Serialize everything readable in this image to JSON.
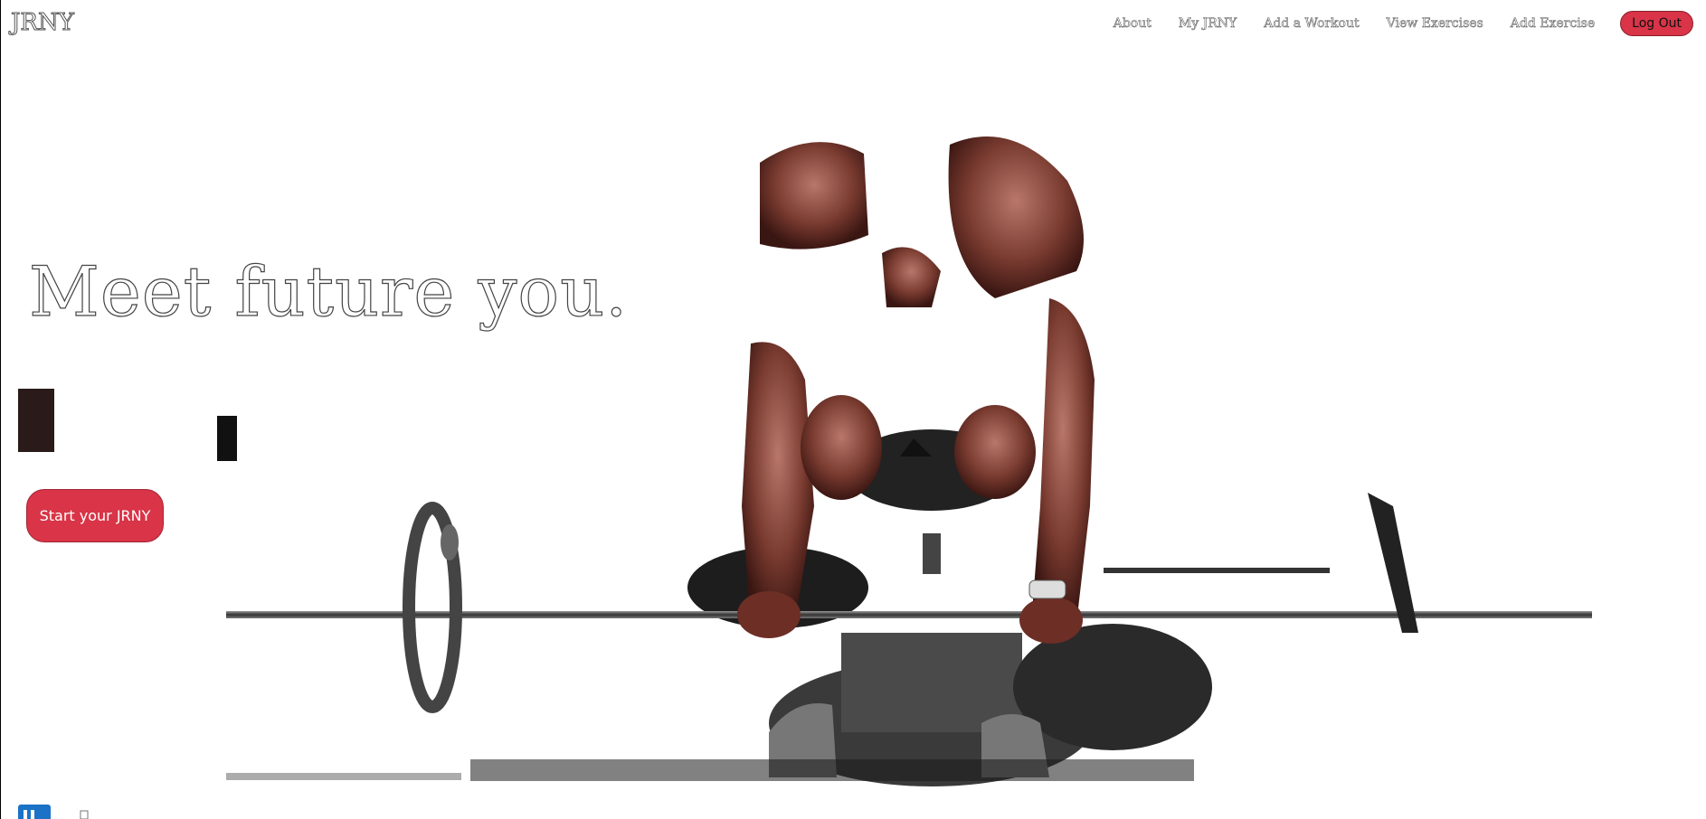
{
  "brand": "JRNY",
  "nav": {
    "items": [
      "About",
      "My JRNY",
      "Add a Workout",
      "View Exercises",
      "Add Exercise"
    ],
    "logout_label": "Log Out"
  },
  "hero": {
    "title": "Meet future you.",
    "cta_label": "Start your JRNY"
  },
  "colors": {
    "accent": "#d93447",
    "background": "#ffffff"
  },
  "icons": {
    "footer": "linkedin-icon"
  }
}
